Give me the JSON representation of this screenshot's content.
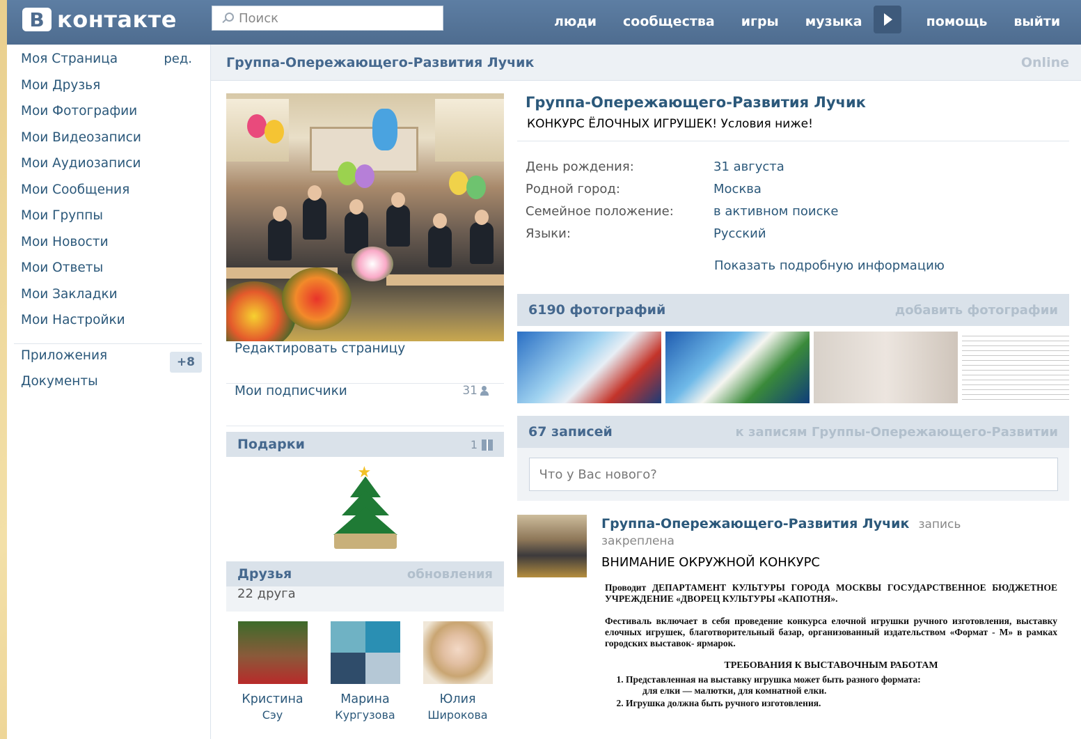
{
  "header": {
    "logo_letter": "В",
    "logo_text": "контакте",
    "search_placeholder": "Поиск",
    "nav": [
      "люди",
      "сообщества",
      "игры",
      "музыка"
    ],
    "help": "помощь",
    "logout": "выйти"
  },
  "sidebar": {
    "items": [
      "Моя Страница",
      "Мои Друзья",
      "Мои Фотографии",
      "Мои Видеозаписи",
      "Мои Аудиозаписи",
      "Мои Сообщения",
      "Мои Группы",
      "Мои Новости",
      "Мои Ответы",
      "Мои Закладки",
      "Мои Настройки"
    ],
    "edit": "ред.",
    "apps": "Приложения",
    "apps_badge": "+8",
    "docs": "Документы"
  },
  "page": {
    "title": "Группа-Опережающего-Развития Лучик",
    "online": "Online"
  },
  "left": {
    "edit_page": "Редактировать страницу",
    "subscribers": "Мои подписчики",
    "subscribers_count": "31",
    "gifts_title": "Подарки",
    "gifts_count": "1",
    "friends_title": "Друзья",
    "friends_updates": "обновления",
    "friends_count": "22 друга",
    "friends": [
      {
        "first": "Кристина",
        "last": "Сэу"
      },
      {
        "first": "Марина",
        "last": "Кургузова"
      },
      {
        "first": "Юлия",
        "last": "Широкова"
      }
    ]
  },
  "profile": {
    "name": "Группа-Опережающего-Развития Лучик",
    "status": "КОНКУРС ЁЛОЧНЫХ ИГРУШЕК! Условия ниже!",
    "info": [
      {
        "k": "День рождения:",
        "v": "31 августа"
      },
      {
        "k": "Родной город:",
        "v": "Москва"
      },
      {
        "k": "Семейное положение:",
        "v": "в активном поиске"
      },
      {
        "k": "Языки:",
        "v": "Русский"
      }
    ],
    "show_more": "Показать подробную информацию"
  },
  "photos": {
    "count": "6190 фотографий",
    "add": "добавить фотографии"
  },
  "wall": {
    "count": "67 записей",
    "link": "к записям Группы-Опережающего-Развитии",
    "placeholder": "Что у Вас нового?"
  },
  "post": {
    "author": "Группа-Опережающего-Развития Лучик",
    "meta1": "запись",
    "meta2": "закреплена",
    "text": "ВНИМАНИЕ ОКРУЖНОЙ КОНКУРС",
    "doc_p1": "Проводит ДЕПАРТАМЕНТ КУЛЬТУРЫ ГОРОДА МОСКВЫ ГОСУДАРСТВЕННОЕ БЮДЖЕТНОЕ УЧРЕЖДЕНИЕ «ДВОРЕЦ КУЛЬТУРЫ «КАПОТНЯ».",
    "doc_p2": "Фестиваль включает в себя проведение конкурса елочной игрушки ручного изготовления, выставку елочных игрушек, благотворительный базар, организованный издательством «Формат - М» в рамках городских выставок- ярмарок.",
    "doc_heading": "ТРЕБОВАНИЯ К ВЫСТАВОЧНЫМ РАБОТАМ",
    "doc_li1": "Представленная на выставку игрушка может быть разного формата:",
    "doc_li1b": "для елки — малютки, для комнатной елки.",
    "doc_li2": "Игрушка должна быть ручного изготовления."
  }
}
